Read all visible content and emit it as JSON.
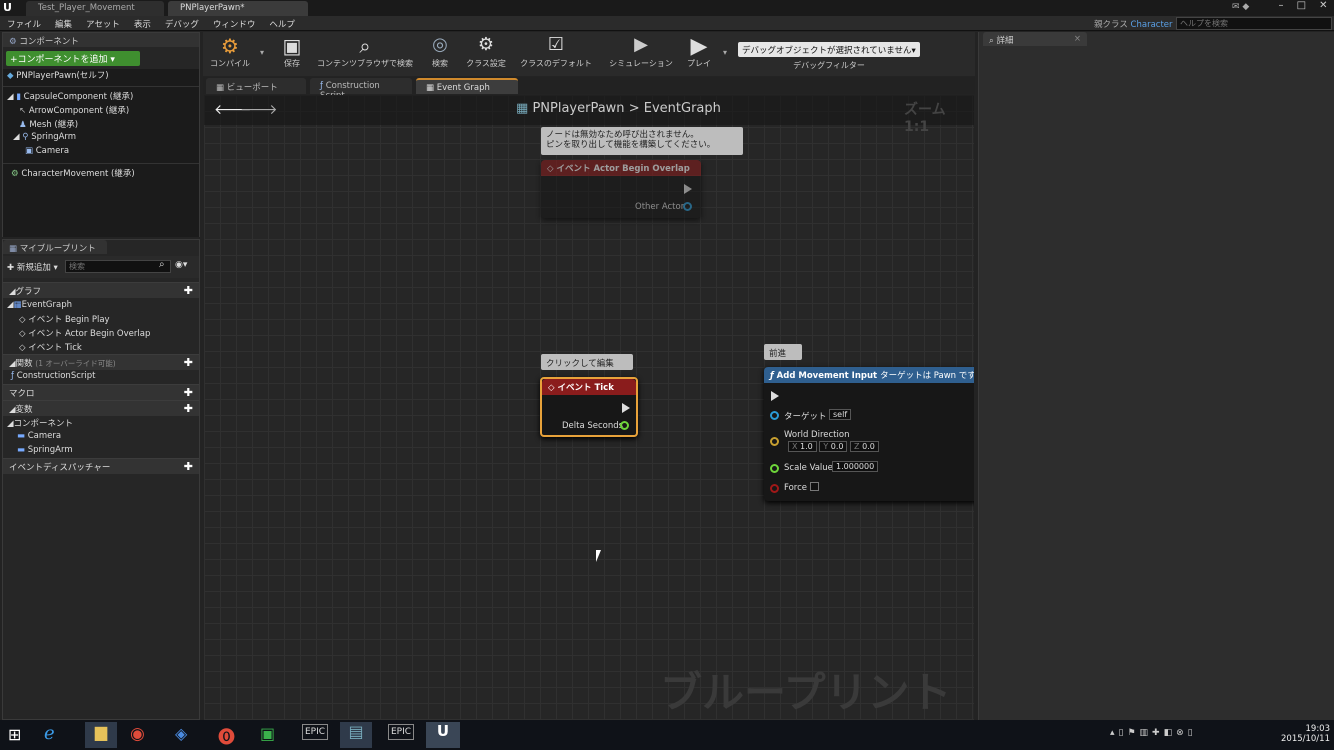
{
  "window": {
    "tab1": "Test_Player_Movement",
    "tab2": "PNPlayerPawn*",
    "parent_class_label": "親クラス",
    "parent_class": "Character",
    "help_search_placeholder": "ヘルプを検索"
  },
  "menu": [
    "ファイル",
    "編集",
    "アセット",
    "表示",
    "デバッグ",
    "ウィンドウ",
    "ヘルプ"
  ],
  "components_panel": {
    "title": "コンポーネント",
    "add_button": "+コンポーネントを追加 ▾",
    "self": "PNPlayerPawn(セルフ)",
    "items": [
      "CapsuleComponent (継承)",
      "ArrowComponent (継承)",
      "Mesh (継承)",
      "SpringArm",
      "Camera",
      "CharacterMovement (継承)"
    ]
  },
  "my_blueprint": {
    "title": "マイブループリント",
    "add_new": "新規追加 ▾",
    "search_placeholder": "検索",
    "graphs_label": "グラフ",
    "event_graph": "EventGraph",
    "events": [
      "イベント Begin Play",
      "イベント Actor Begin Overlap",
      "イベント Tick"
    ],
    "functions_label": "関数",
    "functions_note": "(1 オーバーライド可能)",
    "construction": "ConstructionScript",
    "macros_label": "マクロ",
    "variables_label": "変数",
    "components_label": "コンポーネント",
    "comp_vars": [
      "Camera",
      "SpringArm"
    ],
    "dispatchers_label": "イベントディスパッチャー"
  },
  "toolbar": {
    "buttons": [
      "コンパイル",
      "保存",
      "コンテンツブラウザで検索",
      "検索",
      "クラス設定",
      "クラスのデフォルト",
      "シミュレーション",
      "プレイ"
    ],
    "debug_select": "デバッグオブジェクトが選択されていません▾",
    "debug_filter": "デバッグフィルター"
  },
  "doc_tabs": [
    "ビューポート",
    "Construction Script",
    "Event Graph"
  ],
  "graph": {
    "breadcrumb_root": "PNPlayerPawn",
    "breadcrumb_sep": ">",
    "breadcrumb_leaf": "EventGraph",
    "zoom": "ズーム 1:1",
    "watermark": "ブループリント"
  },
  "node_overlap": {
    "comment": "ノードは無効なため呼び出されません。\nピンを取り出して機能を構築してください。",
    "title": "イベント Actor Begin Overlap",
    "pin": "Other Actor"
  },
  "node_tick": {
    "comment": "クリックして編集",
    "title": "イベント Tick",
    "pin": "Delta Seconds"
  },
  "node_move": {
    "comment": "前進",
    "title": "Add Movement Input",
    "subtitle": "ターゲットは Pawn です",
    "target_label": "ターゲット",
    "target_val": "self",
    "dir_label": "World Direction",
    "x_label": "X",
    "x": "1.0",
    "y_label": "Y",
    "y": "0.0",
    "z_label": "Z",
    "z": "0.0",
    "scale_label": "Scale Value",
    "scale": "1.000000",
    "force_label": "Force"
  },
  "details": {
    "title": "詳細"
  },
  "clock": {
    "time": "19:03",
    "date": "2015/10/11"
  },
  "colors": {
    "accent_green": "#3f8f2f",
    "node_red": "#8a1c1c",
    "pin_blue": "#2a9bd6",
    "pin_yellow": "#c8a030",
    "pin_green": "#6ed63a",
    "pin_red": "#a01818"
  }
}
